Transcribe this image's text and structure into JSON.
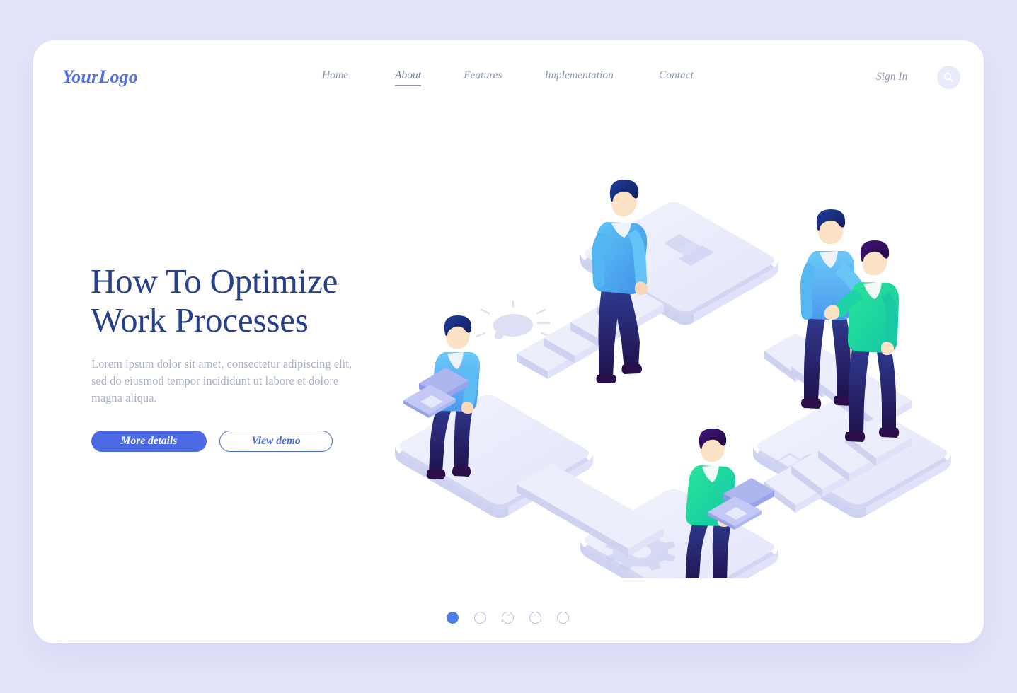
{
  "page": {
    "background_color": "#e4e4fa",
    "card_color": "#ffffff"
  },
  "header": {
    "logo": "YourLogo",
    "nav": [
      {
        "label": "Home",
        "active": false
      },
      {
        "label": "About",
        "active": true
      },
      {
        "label": "Features",
        "active": false
      },
      {
        "label": "Implementation",
        "active": false
      },
      {
        "label": "Contact",
        "active": false
      }
    ],
    "signin_label": "Sign In",
    "search_icon": "search-icon"
  },
  "hero": {
    "headline_line1": "How To Optimize",
    "headline_line2": "Work Processes",
    "paragraph": "Lorem ipsum dolor sit amet, consectetur adipiscing elit, sed do eiusmod tempor incididunt ut labore et dolore magna aliqua.",
    "primary_button": "More details",
    "secondary_button": "View demo",
    "headline_color": "#26408b",
    "accent_color": "#4c6ae4"
  },
  "carousel": {
    "total": 5,
    "active_index": 1,
    "active_color": "#4c7de8",
    "inactive_color": "#b9bfe0"
  },
  "illustration": {
    "name": "isometric-work-processes",
    "platform_icons": [
      "bar-chart-icon",
      "lightbulb-icon",
      "gear-icon",
      "thumbs-up-icon"
    ],
    "figures": [
      {
        "name": "man-walking-upstairs",
        "shirt_color": "#3fa9f5"
      },
      {
        "name": "man-seated-with-laptop-left",
        "shirt_color": "#4aa8f0"
      },
      {
        "name": "man-handshake-blue",
        "shirt_color": "#5aaef2"
      },
      {
        "name": "man-handshake-green",
        "shirt_color": "#17d99a"
      },
      {
        "name": "man-seated-with-laptop-bottom",
        "shirt_color": "#17d99a"
      }
    ],
    "platform_color": "#e6e8fa",
    "platform_top_color": "#eef0fd"
  }
}
